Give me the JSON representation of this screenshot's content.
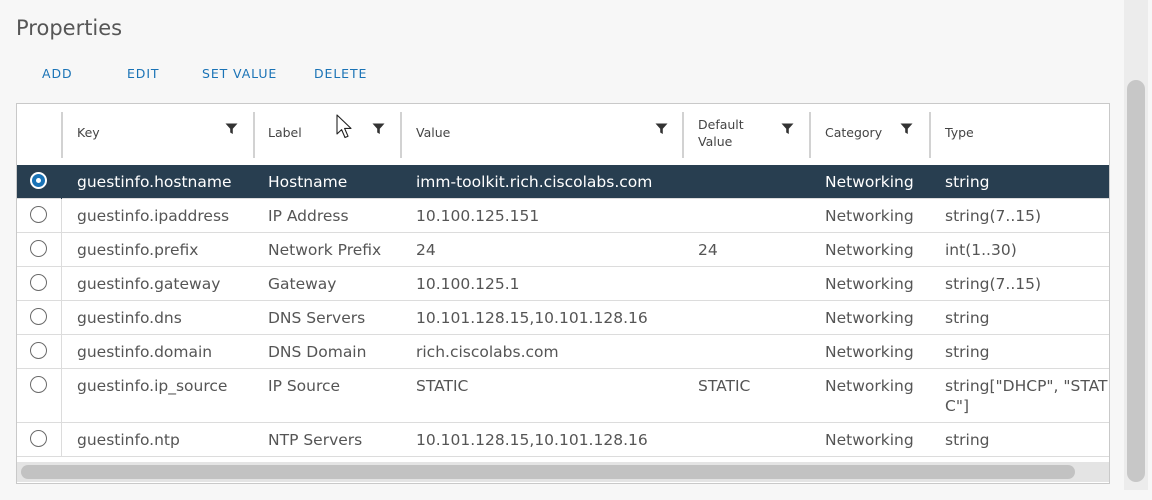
{
  "page": {
    "title": "Properties"
  },
  "toolbar": {
    "add": "ADD",
    "edit": "EDIT",
    "set_value": "SET VALUE",
    "delete": "DELETE"
  },
  "grid": {
    "columns": {
      "key": "Key",
      "label": "Label",
      "value": "Value",
      "default_value_line1": "Default",
      "default_value_line2": "Value",
      "category": "Category",
      "type": "Type"
    },
    "rows": [
      {
        "key": "guestinfo.hostname",
        "label": "Hostname",
        "value": "imm-toolkit.rich.ciscolabs.com",
        "default": "",
        "category": "Networking",
        "type": "string",
        "type2": "",
        "selected": true
      },
      {
        "key": "guestinfo.ipaddress",
        "label": "IP Address",
        "value": "10.100.125.151",
        "default": "",
        "category": "Networking",
        "type": "string(7..15)",
        "type2": "",
        "selected": false
      },
      {
        "key": "guestinfo.prefix",
        "label": "Network Prefix",
        "value": "24",
        "default": "24",
        "category": "Networking",
        "type": "int(1..30)",
        "type2": "",
        "selected": false
      },
      {
        "key": "guestinfo.gateway",
        "label": "Gateway",
        "value": "10.100.125.1",
        "default": "",
        "category": "Networking",
        "type": "string(7..15)",
        "type2": "",
        "selected": false
      },
      {
        "key": "guestinfo.dns",
        "label": "DNS Servers",
        "value": "10.101.128.15,10.101.128.16",
        "default": "",
        "category": "Networking",
        "type": "string",
        "type2": "",
        "selected": false
      },
      {
        "key": "guestinfo.domain",
        "label": "DNS Domain",
        "value": "rich.ciscolabs.com",
        "default": "",
        "category": "Networking",
        "type": "string",
        "type2": "",
        "selected": false
      },
      {
        "key": "guestinfo.ip_source",
        "label": "IP Source",
        "value": "STATIC",
        "default": "STATIC",
        "category": "Networking",
        "type": "string[\"DHCP\", \"STATI",
        "type2": "C\"]",
        "selected": false
      },
      {
        "key": "guestinfo.ntp",
        "label": "NTP Servers",
        "value": "10.101.128.15,10.101.128.16",
        "default": "",
        "category": "Networking",
        "type": "string",
        "type2": "",
        "selected": false
      }
    ]
  },
  "icons": {
    "filter": "filter-funnel-icon",
    "cursor": "mouse-pointer-icon",
    "radio": "radio-button-icon"
  },
  "colors": {
    "accent": "#1a73b6",
    "selected_row": "#283e50",
    "background": "#f7f7f7"
  }
}
